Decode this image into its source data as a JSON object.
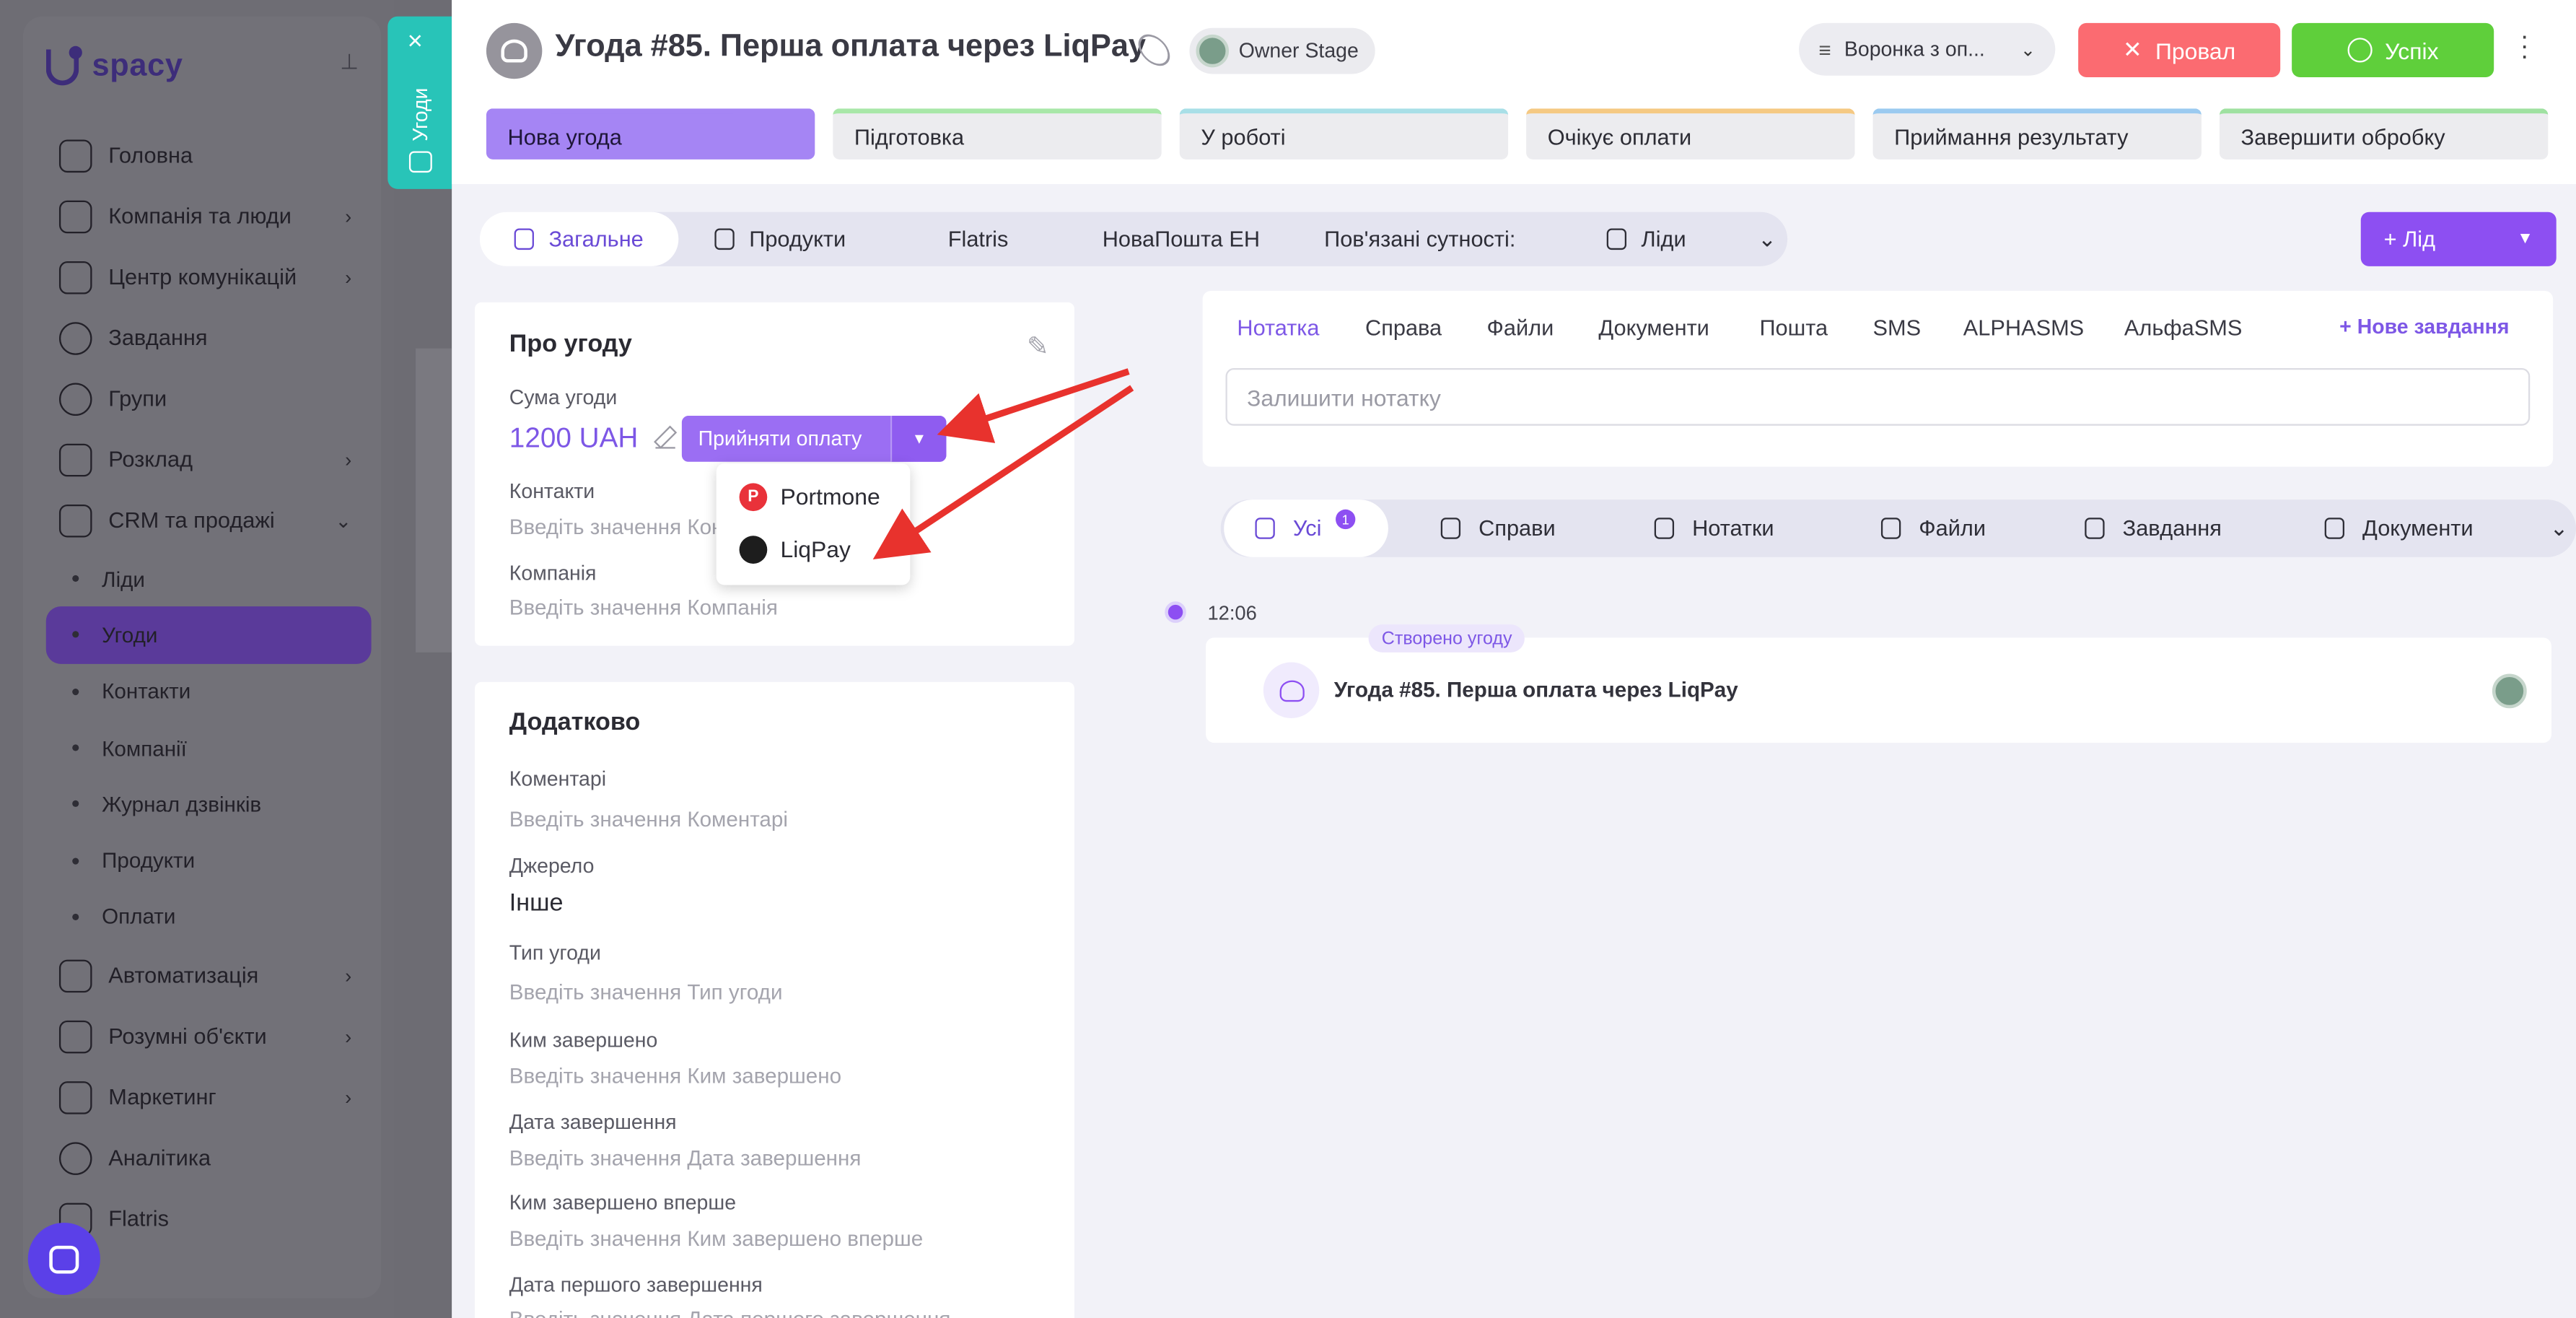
{
  "sidebar": {
    "logo_text": "spacy",
    "nav": [
      {
        "label": "Головна"
      },
      {
        "label": "Компанія та люди"
      },
      {
        "label": "Центр комунікацій"
      },
      {
        "label": "Завдання"
      },
      {
        "label": "Групи"
      },
      {
        "label": "Розклад"
      },
      {
        "label": "CRM та продажі"
      }
    ],
    "crm_sub": [
      "Ліди",
      "Угоди",
      "Контакти",
      "Компанії",
      "Журнал дзвінків",
      "Продукти",
      "Оплати"
    ],
    "nav_bottom": [
      "Автоматизація",
      "Розумні об'єкти",
      "Маркетинг",
      "Аналітика",
      "Flatris"
    ]
  },
  "overlay_tab": {
    "label": "Угоди"
  },
  "header": {
    "title": "Угода #85. Перша оплата через LiqPay",
    "owner_stage": "Owner Stage",
    "funnel": "Воронка з оп...",
    "fail_label": "Провал",
    "success_label": "Успіх"
  },
  "stages": [
    "Нова угода",
    "Підготовка",
    "У роботі",
    "Очікує оплати",
    "Приймання результату",
    "Завершити обробку"
  ],
  "tabs": {
    "general": "Загальне",
    "products": "Продукти",
    "flatris": "Flatris",
    "novaposhta": "НоваПошта ЕН",
    "related": "Пов'язані сутності:",
    "leads": "Ліди",
    "add_lead": "+ Лід"
  },
  "about": {
    "title": "Про угоду",
    "sum_label": "Сума угоди",
    "sum_value": "1200 UAH",
    "pay_button": "Прийняти оплату",
    "contacts_label": "Контакти",
    "contacts_placeholder": "Введіть значення Контакти",
    "company_label": "Компанія",
    "company_placeholder": "Введіть значення Компанія"
  },
  "payment_menu": {
    "portmone": "Portmone",
    "liqpay": "LiqPay"
  },
  "extra": {
    "title": "Додатково",
    "fields": [
      {
        "label": "Коментарі",
        "placeholder": "Введіть значення Коментарі"
      },
      {
        "label": "Джерело",
        "value": "Інше"
      },
      {
        "label": "Тип угоди",
        "placeholder": "Введіть значення Тип угоди"
      },
      {
        "label": "Ким завершено",
        "placeholder": "Введіть значення Ким завершено"
      },
      {
        "label": "Дата завершення",
        "placeholder": "Введіть значення Дата завершення"
      },
      {
        "label": "Ким завершено вперше",
        "placeholder": "Введіть значення Ким завершено вперше"
      },
      {
        "label": "Дата першого завершення",
        "placeholder": "Введіть значення Дата першого завершення"
      }
    ]
  },
  "activity": {
    "tabs": [
      "Нотатка",
      "Справа",
      "Файли",
      "Документи",
      "Пошта",
      "SMS",
      "ALPHASMS",
      "АльфаSMS"
    ],
    "new_task": "+ Нове завдання",
    "note_placeholder": "Залишити нотатку"
  },
  "feed": {
    "tabs": [
      "Усі",
      "Справи",
      "Нотатки",
      "Файли",
      "Завдання",
      "Документи"
    ],
    "all_count": "1",
    "time": "12:06",
    "event_badge": "Створено угоду",
    "event_title": "Угода #85. Перша оплата через LiqPay"
  },
  "colors": {
    "accent": "#8d4ff2",
    "fail": "#fb6b71",
    "success": "#5fcf3b",
    "overlay_tab": "#28c4b8",
    "arrow": "#e8322d"
  }
}
